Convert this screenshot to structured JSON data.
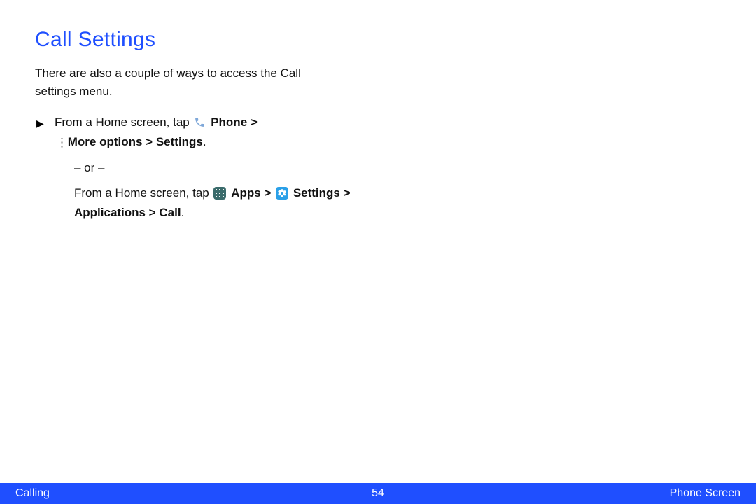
{
  "title": "Call Settings",
  "intro": "There are also a couple of ways to access the Call settings menu.",
  "step1": {
    "prefix": "From a Home screen, tap ",
    "phone_label": "Phone",
    "gt1": " > ",
    "more_options": "More options",
    "gt2": " > ",
    "settings": "Settings",
    "period": "."
  },
  "or_text": "– or –",
  "step2": {
    "prefix": "From a Home screen, tap ",
    "apps_label": "Apps",
    "gt1": " > ",
    "settings_label": "Settings",
    "gt2": " > ",
    "applications": "Applications",
    "gt3": " > ",
    "call": "Call",
    "period": "."
  },
  "footer": {
    "left": "Calling",
    "center": "54",
    "right": "Phone Screen"
  }
}
